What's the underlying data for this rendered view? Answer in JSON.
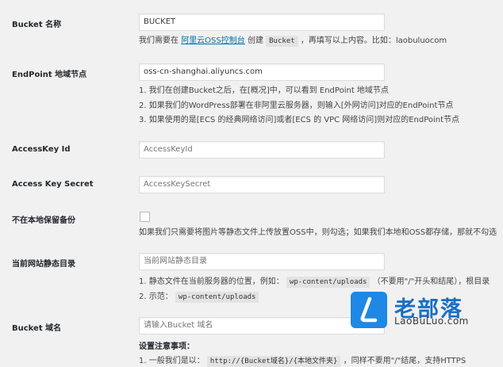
{
  "fields": {
    "bucket_name": {
      "label": "Bucket 名称",
      "value": "BUCKET",
      "desc_pre": "我们需要在",
      "desc_link": "阿里云OSS控制台",
      "desc_mid": "创建",
      "desc_code": "Bucket",
      "desc_post": "，再填写以上内容。比如：laobuluocom"
    },
    "endpoint": {
      "label": "EndPoint 地域节点",
      "value": "oss-cn-shanghai.aliyuncs.com",
      "notes": [
        "1. 我们在创建Bucket之后，在[概况]中，可以看到 EndPoint 地域节点",
        "2. 如果我们的WordPress部署在非阿里云服务器，则输入[外网访问]对应的EndPoint节点",
        "3. 如果使用的是[ECS 的经典网络访问]或者[ECS 的 VPC 网络访问]则对应的EndPoint节点"
      ]
    },
    "access_key_id": {
      "label": "AccessKey Id",
      "placeholder": "AccessKeyId"
    },
    "access_key_secret": {
      "label": "Access Key Secret",
      "placeholder": "AccessKeySecret"
    },
    "no_local_backup": {
      "label": "不在本地保留备份",
      "desc": "如果我们只需要将图片等静态文件上传放置OSS中，则勾选；如果我们本地和OSS都存储，那就不勾选"
    },
    "static_dir": {
      "label": "当前网站静态目录",
      "placeholder": "当前网站静态目录",
      "note1_pre": "1. 静态文件在当前服务器的位置，例如：",
      "note1_code": "wp-content/uploads",
      "note1_post": "（不要用\"/\"开头和结尾），根目录",
      "note2_pre": "2. 示范：",
      "note2_code": "wp-content/uploads"
    },
    "bucket_domain": {
      "label": "Bucket 域名",
      "placeholder": "请输入Bucket 域名",
      "settings_title": "设置注意事项：",
      "note1_pre": "1. 一般我们是以：",
      "note1_code": "http://{Bucket域名}/{本地文件夹}",
      "note1_post": "，同样不要用\"/\"结尾，支持HTTPS"
    }
  },
  "watermark": {
    "title": "老部落",
    "url": "LaoBuLuo.com",
    "brand_color": "#1e88e5"
  }
}
